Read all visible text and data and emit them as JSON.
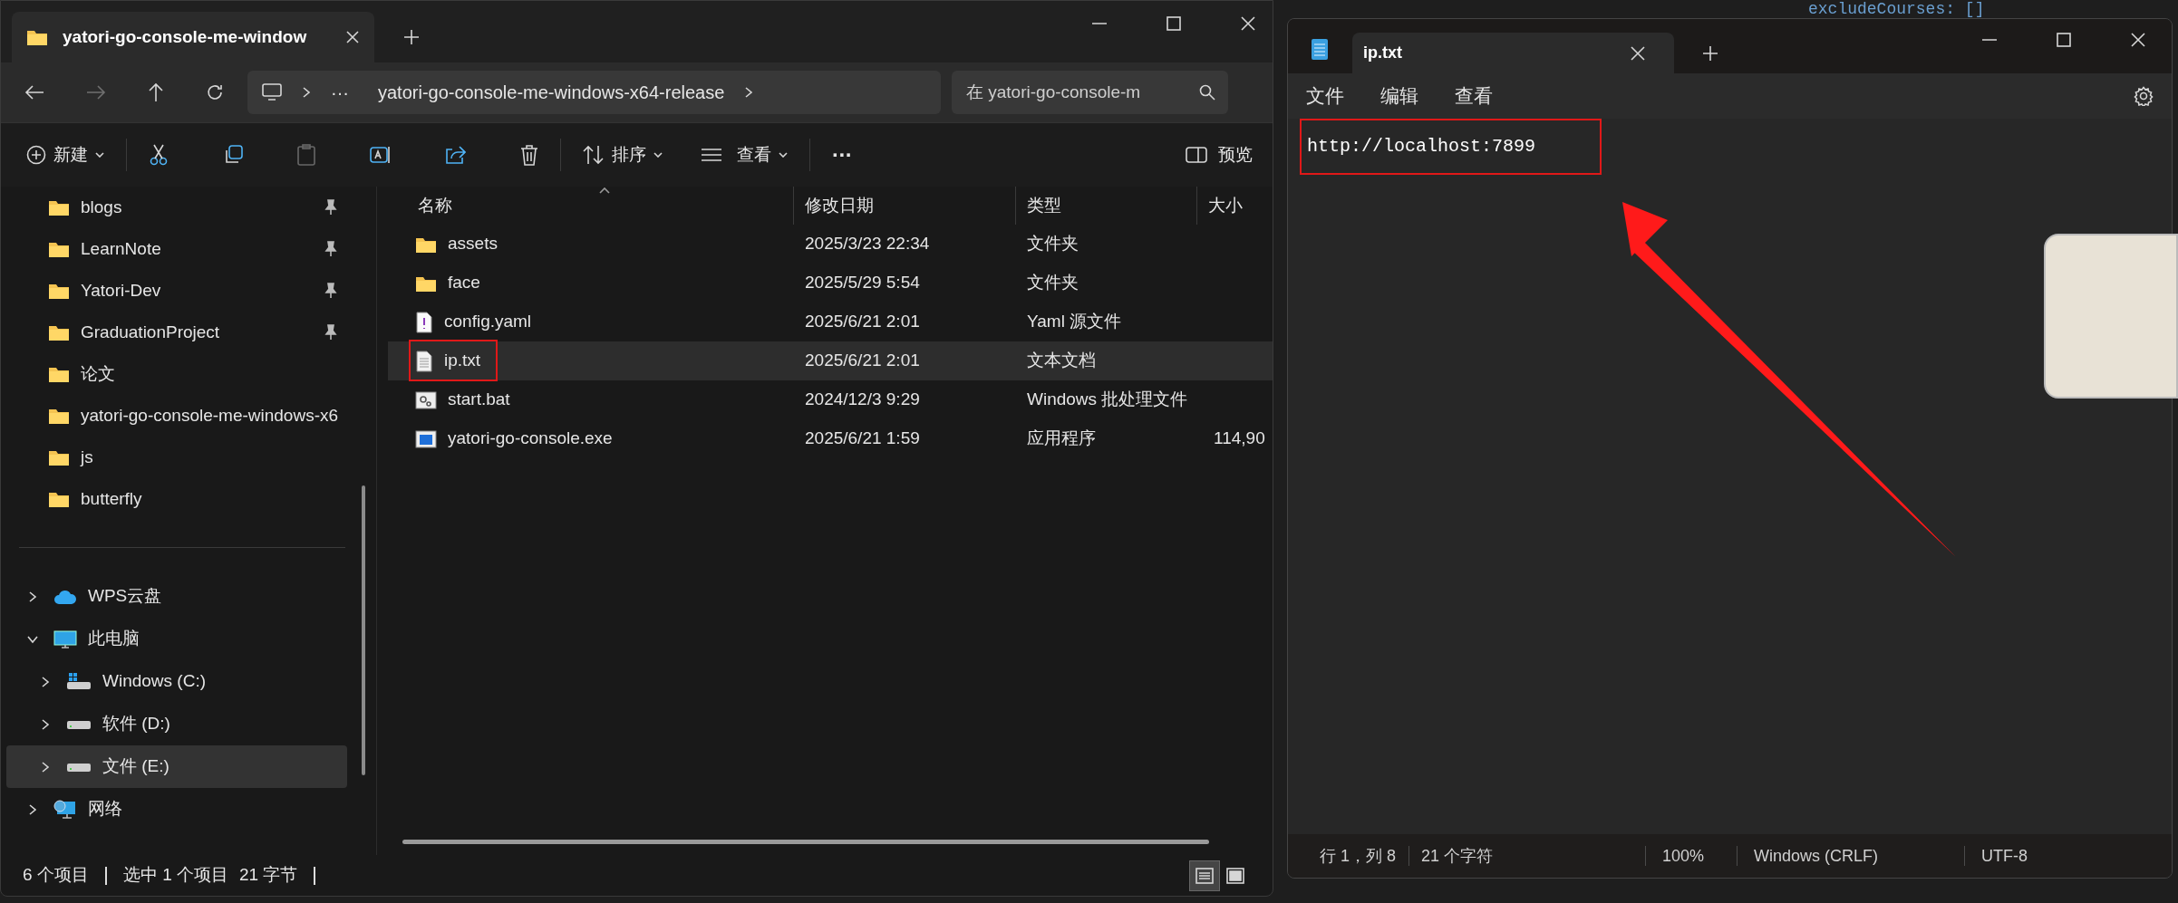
{
  "background": {
    "code_line": "excludeCourses: []"
  },
  "explorer": {
    "tab": {
      "title": "yatori-go-console-me-window"
    },
    "address": {
      "ellipsis": "···",
      "path": "yatori-go-console-me-windows-x64-release"
    },
    "search": {
      "placeholder": "在 yatori-go-console-m"
    },
    "toolbar": {
      "new": "新建",
      "sort": "排序",
      "view": "查看",
      "more": "···",
      "preview": "预览"
    },
    "quick_access": [
      {
        "label": "blogs",
        "pinned": true
      },
      {
        "label": "LearnNote",
        "pinned": true
      },
      {
        "label": "Yatori-Dev",
        "pinned": true
      },
      {
        "label": "GraduationProject",
        "pinned": true
      },
      {
        "label": "论文",
        "pinned": false
      },
      {
        "label": "yatori-go-console-me-windows-x6",
        "pinned": false
      },
      {
        "label": "js",
        "pinned": false
      },
      {
        "label": "butterfly",
        "pinned": false
      }
    ],
    "tree": [
      {
        "label": "WPS云盘",
        "kind": "cloud",
        "expanded": false,
        "selected": false
      },
      {
        "label": "此电脑",
        "kind": "pc",
        "expanded": true,
        "selected": false,
        "children": [
          {
            "label": "Windows (C:)",
            "kind": "system-drive",
            "expanded": false,
            "selected": false
          },
          {
            "label": "软件 (D:)",
            "kind": "drive",
            "expanded": false,
            "selected": false
          },
          {
            "label": "文件 (E:)",
            "kind": "drive",
            "expanded": false,
            "selected": true
          }
        ]
      },
      {
        "label": "网络",
        "kind": "network",
        "expanded": false,
        "selected": false
      }
    ],
    "columns": [
      "名称",
      "修改日期",
      "类型",
      "大小"
    ],
    "rows": [
      {
        "kind": "folder",
        "name": "assets",
        "date": "2025/3/23 22:34",
        "type": "文件夹",
        "selected": false,
        "annotated": false
      },
      {
        "kind": "folder",
        "name": "face",
        "date": "2025/5/29 5:54",
        "type": "文件夹",
        "selected": false,
        "annotated": false
      },
      {
        "kind": "yaml",
        "name": "config.yaml",
        "date": "2025/6/21 2:01",
        "type": "Yaml 源文件",
        "selected": false,
        "annotated": false
      },
      {
        "kind": "text",
        "name": "ip.txt",
        "date": "2025/6/21 2:01",
        "type": "文本文档",
        "selected": true,
        "annotated": true
      },
      {
        "kind": "batch",
        "name": "start.bat",
        "date": "2024/12/3 9:29",
        "type": "Windows 批处理文件",
        "selected": false,
        "annotated": false
      },
      {
        "kind": "exe",
        "name": "yatori-go-console.exe",
        "date": "2025/6/21 1:59",
        "type": "应用程序",
        "size": "114,90",
        "selected": false,
        "annotated": false
      }
    ],
    "status_bar": {
      "count": "6 个项目",
      "selection": "选中 1 个项目",
      "bytes": "21 字节",
      "views": [
        {
          "kind": "details",
          "selected": true
        },
        {
          "kind": "tiles",
          "selected": false
        }
      ]
    }
  },
  "notepad": {
    "tab": {
      "title": "ip.txt"
    },
    "menu": [
      "文件",
      "编辑",
      "查看"
    ],
    "content": {
      "text": "http://localhost:7899",
      "annotated": true
    },
    "status_bar": {
      "position": "行 1，列 8",
      "chars": "21 个字符",
      "zoom": "100%",
      "line_ending": "Windows (CRLF)",
      "encoding": "UTF-8"
    }
  }
}
